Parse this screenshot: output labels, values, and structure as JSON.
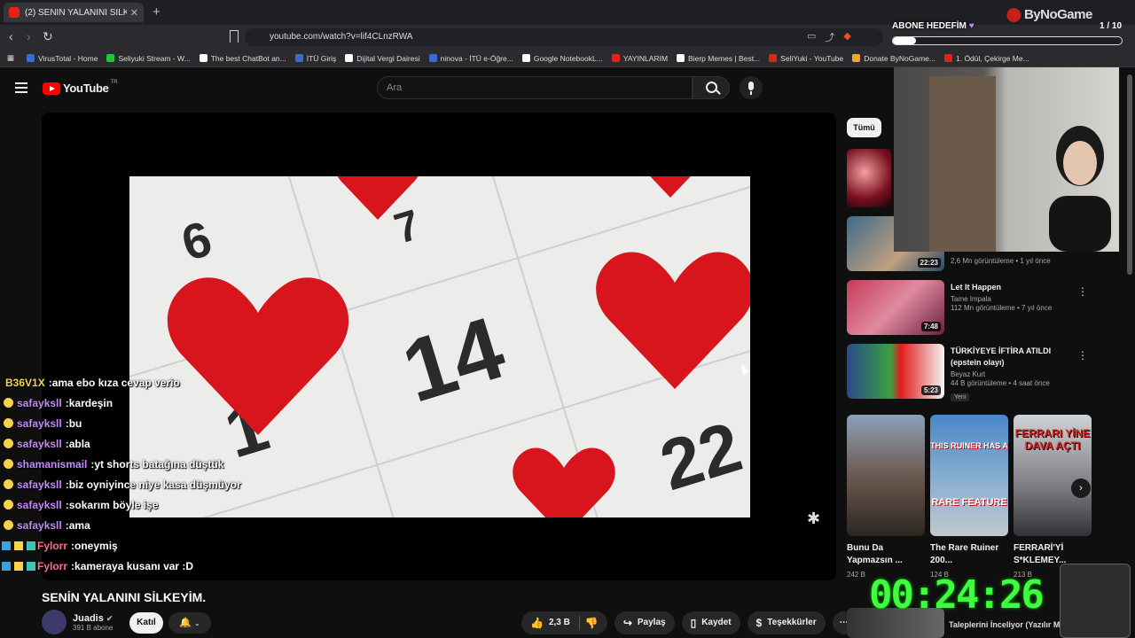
{
  "browser": {
    "tab_title": "(2) SENİN YALANINI SİLKEYİM...",
    "url": "youtube.com/watch?v=lif4CLnzRWA",
    "bookmarks": [
      {
        "label": "VirusTotal - Home",
        "color": "#3a6ad6"
      },
      {
        "label": "Seliyuki Stream - W...",
        "color": "#19c937"
      },
      {
        "label": "The best ChatBot an...",
        "color": "#ffffff"
      },
      {
        "label": "İTÜ Giriş",
        "color": "#3a6ad6"
      },
      {
        "label": "Dijital Vergi Dairesi",
        "color": "#ffffff"
      },
      {
        "label": "ninova - İTÜ e-Öğre...",
        "color": "#3a6ad6"
      },
      {
        "label": "Google NotebookL...",
        "color": "#ffffff"
      },
      {
        "label": "YAYINLARIM",
        "color": "#e62117"
      },
      {
        "label": "Bierp Memes | Best...",
        "color": "#ffffff"
      },
      {
        "label": "SeliYuki - YouTube",
        "color": "#e62117"
      },
      {
        "label": "Donate ByNoGame...",
        "color": "#f5a623"
      },
      {
        "label": "1. Ödül, Çekirge Me...",
        "color": "#e62117"
      }
    ]
  },
  "youtube": {
    "logo": "YouTube",
    "region": "TR",
    "search_placeholder": "Ara",
    "chip_all": "Tümü",
    "video": {
      "title": "SENİN YALANINI SİLKEYİM.",
      "channel": "Juadis",
      "subs": "391 B abone",
      "join": "Katıl",
      "likes": "2,3 B",
      "share": "Paylaş",
      "save": "Kaydet",
      "thanks": "Teşekkürler"
    },
    "thumb_numbers": {
      "n14": "14",
      "n6": "6",
      "n22": "22",
      "n1": "1",
      "n7": "7"
    }
  },
  "chat": [
    {
      "user": "B36V1X",
      "msg": "ama ebo kıza cevap verio",
      "color": "#f5d34a",
      "badge": "none"
    },
    {
      "user": "safayksll",
      "msg": "kardeşin",
      "color": "#c58af9",
      "badge": "one"
    },
    {
      "user": "safayksll",
      "msg": "bu",
      "color": "#c58af9",
      "badge": "one"
    },
    {
      "user": "safayksll",
      "msg": "abla",
      "color": "#c58af9",
      "badge": "one"
    },
    {
      "user": "shamanismail",
      "msg": "yt shorts batağına düştük",
      "color": "#c58af9",
      "badge": "one"
    },
    {
      "user": "safayksll",
      "msg": "biz oyniyince niye kasa düşmüyor",
      "color": "#c58af9",
      "badge": "one"
    },
    {
      "user": "safayksll",
      "msg": "sokarım böyle işe",
      "color": "#c58af9",
      "badge": "one"
    },
    {
      "user": "safayksll",
      "msg": "ama",
      "color": "#c58af9",
      "badge": "one"
    },
    {
      "user": "Fylorr",
      "msg": "oneymiş",
      "color": "#ff6b8a",
      "badge": "multi"
    },
    {
      "user": "Fylorr",
      "msg": "kameraya kusanı var :D",
      "color": "#ff6b8a",
      "badge": "multi"
    }
  ],
  "recommendations": [
    {
      "title": "",
      "channel": "",
      "meta": "2,6 Mn görüntüleme • 1 yıl önce",
      "duration": "22:23",
      "new": ""
    },
    {
      "title": "Let It Happen",
      "channel": "Tame Impala",
      "meta": "112 Mn görüntüleme • 7 yıl önce",
      "duration": "7:48",
      "new": ""
    },
    {
      "title": "TÜRKİYEYE İFTİRA ATILDI (epstein olayı)",
      "channel": "Beyaz Kurt",
      "meta": "44 B görüntüleme • 4 saat önce",
      "duration": "5:23",
      "new": "Yeni"
    }
  ],
  "shorts": [
    {
      "title": "Bunu Da Yapmazsın ...",
      "views": "242 B"
    },
    {
      "title": "The Rare Ruiner 200...",
      "views": "124 B"
    },
    {
      "title": "FERRARİ'Yİ S*KLEMEY...",
      "views": "213 B"
    }
  ],
  "shorts_thumb_text": {
    "s2_top": "THIS RUINER HAS A",
    "s2_bottom": "RARE FEATURE",
    "s3_top": "FERRARI YİNE DAVA AÇTI"
  },
  "overlay": {
    "sub_goal_label": "ABONE HEDEFİM",
    "sub_goal_count": "1 / 10",
    "sub_goal_progress": 0.1,
    "brand": "ByNoGame",
    "timer": "00:24:26",
    "partial_bottom_text": "Taleplerini İnceliyor (Yazılır M"
  }
}
